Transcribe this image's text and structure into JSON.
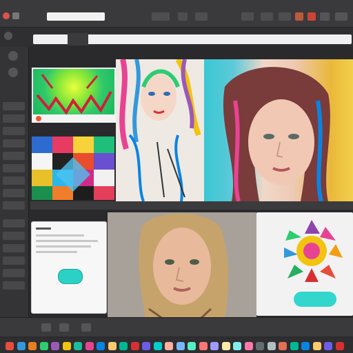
{
  "topbar": {
    "menu_text": "",
    "search_placeholder": ""
  },
  "address": {
    "url": ""
  },
  "dialog": {
    "title": "",
    "button_label": ""
  },
  "action_card": {
    "button_label": ""
  },
  "taskbar_colors": [
    "#e74c3c",
    "#3498db",
    "#e67e22",
    "#2ecc71",
    "#9b59b6",
    "#f1c40f",
    "#1abc9c",
    "#e84393",
    "#0984e3",
    "#fdcb6e",
    "#00b894",
    "#d63031",
    "#6c5ce7",
    "#00cec9",
    "#fab1a0",
    "#74b9ff",
    "#55efc4",
    "#ff7675",
    "#a29bfe",
    "#ffeaa7",
    "#81ecec",
    "#fd79a8",
    "#636e72",
    "#b2bec3",
    "#e17055",
    "#00b894",
    "#0984e3",
    "#fdcb6e",
    "#6c5ce7",
    "#d63031"
  ]
}
